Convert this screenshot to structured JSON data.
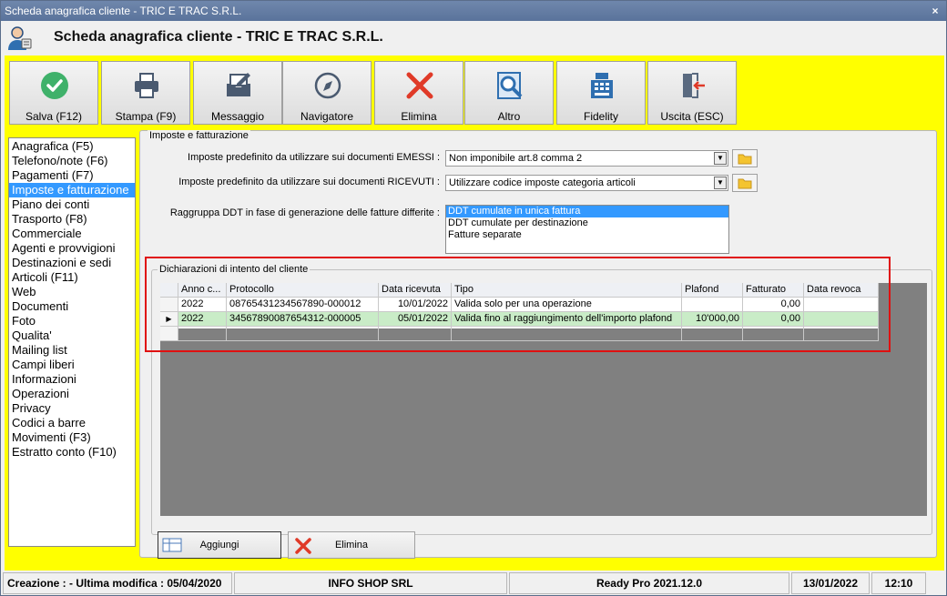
{
  "window": {
    "title": "Scheda anagrafica cliente - TRIC E TRAC S.R.L.",
    "close": "×"
  },
  "header": {
    "title": "Scheda anagrafica cliente - TRIC E TRAC S.R.L."
  },
  "toolbar": [
    {
      "label": "Salva (F12)",
      "icon": "check-circle-icon",
      "color": "#3fb16a"
    },
    {
      "label": "Stampa (F9)",
      "icon": "printer-icon",
      "color": "#4a5a70"
    },
    {
      "label": "Messaggio",
      "icon": "message-edit-icon",
      "color": "#4a5a70"
    },
    {
      "label": "Navigatore",
      "icon": "compass-icon",
      "color": "#4a5a70"
    },
    {
      "label": "Elimina",
      "icon": "delete-x-icon",
      "color": "#e03a28"
    },
    {
      "label": "Altro",
      "icon": "search-document-icon",
      "color": "#2f6fb0"
    },
    {
      "label": "Fidelity",
      "icon": "cash-register-icon",
      "color": "#2f6fb0"
    },
    {
      "label": "Uscita (ESC)",
      "icon": "exit-door-icon",
      "color": "#e03a28"
    }
  ],
  "nav": [
    "Anagrafica (F5)",
    "Telefono/note (F6)",
    "Pagamenti (F7)",
    "Imposte e fatturazione",
    "Piano dei conti",
    "Trasporto (F8)",
    "Commerciale",
    "Agenti e provvigioni",
    "Destinazioni e sedi",
    "Articoli (F11)",
    "Web",
    "Documenti",
    "Foto",
    "Qualita'",
    "Mailing list",
    "Campi liberi",
    "Informazioni",
    "Operazioni",
    "Privacy",
    "Codici a barre",
    "Movimenti (F3)",
    "Estratto conto (F10)"
  ],
  "nav_selected": "Imposte e fatturazione",
  "imposte": {
    "title": "Imposte e fatturazione",
    "emessi_label": "Imposte predefinito da utilizzare sui documenti EMESSI :",
    "emessi_value": "Non imponibile art.8 comma 2",
    "ricevuti_label": "Imposte predefinito da utilizzare sui documenti RICEVUTI :",
    "ricevuti_value": "Utilizzare codice imposte categoria articoli",
    "ddt_label": "Raggruppa DDT in fase di generazione delle fatture differite :",
    "ddt_options": [
      "DDT cumulate in unica fattura",
      "DDT cumulate per destinazione",
      "Fatture separate"
    ],
    "ddt_selected": "DDT cumulate in unica fattura"
  },
  "dichiarazioni": {
    "title": "Dichiarazioni di intento del cliente",
    "columns": [
      "Anno c...",
      "Protocollo",
      "Data ricevuta",
      "Tipo",
      "Plafond",
      "Fatturato",
      "Data revoca"
    ],
    "rows": [
      [
        "2022",
        "08765431234567890-000012",
        "10/01/2022",
        "Valida solo per una operazione",
        "",
        "0,00",
        ""
      ],
      [
        "2022",
        "34567890087654312-000005",
        "05/01/2022",
        "Valida fino al raggiungimento dell'importo plafond",
        "10'000,00",
        "0,00",
        ""
      ]
    ],
    "current_row_marker": "▶",
    "add_label": "Aggiungi",
    "delete_label": "Elimina"
  },
  "status": {
    "created": "Creazione :  - Ultima modifica : 05/04/2020",
    "company": "INFO SHOP SRL",
    "version": "Ready Pro 2021.12.0",
    "date": "13/01/2022",
    "time": "12:10"
  }
}
